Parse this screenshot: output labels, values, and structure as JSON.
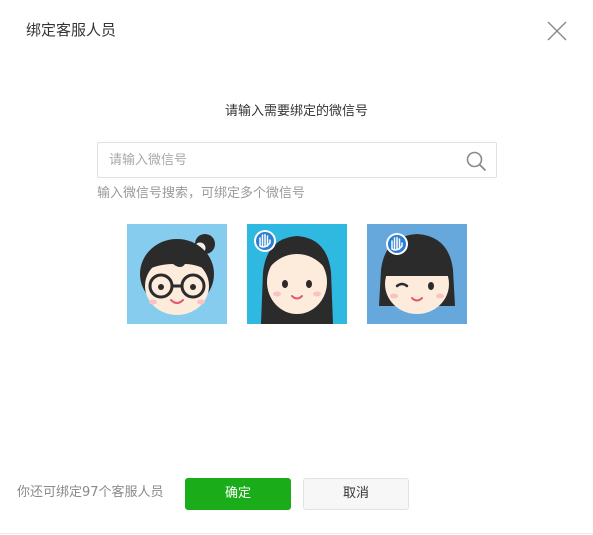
{
  "dialog": {
    "title": "绑定客服人员",
    "close_icon": "close-icon"
  },
  "main": {
    "instruction": "请输入需要绑定的微信号",
    "search": {
      "placeholder": "请输入微信号",
      "value": "",
      "icon": "search-icon"
    },
    "hint": "输入微信号搜索，可绑定多个微信号",
    "avatars": [
      {
        "name": "avatar-glasses-girl",
        "bg": "#86ccef"
      },
      {
        "name": "avatar-long-hair-girl",
        "bg": "#2fb8e0"
      },
      {
        "name": "avatar-winking-girl",
        "bg": "#67a8dc"
      }
    ]
  },
  "footer": {
    "remaining_text": "你还可绑定97个客服人员",
    "confirm_label": "确定",
    "cancel_label": "取消"
  },
  "colors": {
    "primary": "#1aad19",
    "text": "#353535",
    "muted": "#9a9a9a"
  }
}
